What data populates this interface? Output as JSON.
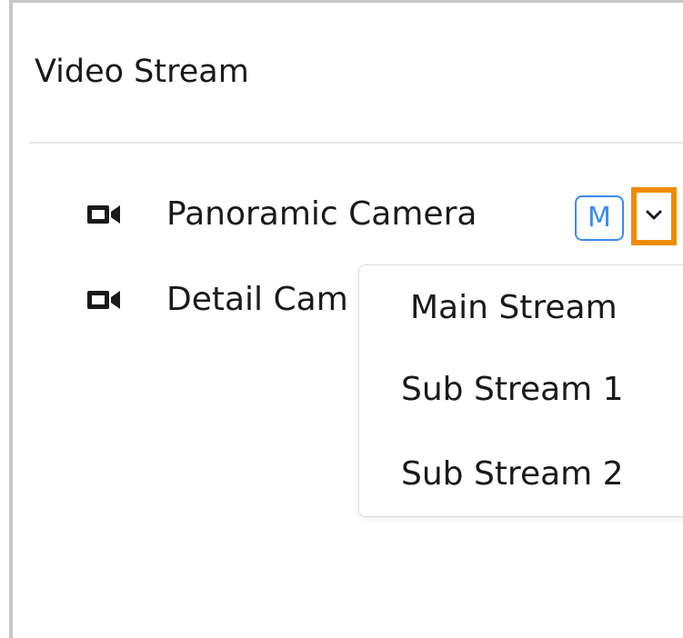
{
  "panel": {
    "title": "Video Stream"
  },
  "cameras": [
    {
      "icon": "video-camera-icon",
      "label": "Panoramic Camera",
      "stream_badge": "M"
    },
    {
      "icon": "video-camera-icon",
      "label": "Detail Cam"
    }
  ],
  "dropdown": {
    "toggle_icon": "chevron-down-icon",
    "highlight_color": "#f08c00",
    "options": [
      "Main Stream",
      "Sub Stream 1",
      "Sub Stream 2"
    ]
  },
  "colors": {
    "accent": "#3b8cf3",
    "highlight": "#f08c00"
  }
}
